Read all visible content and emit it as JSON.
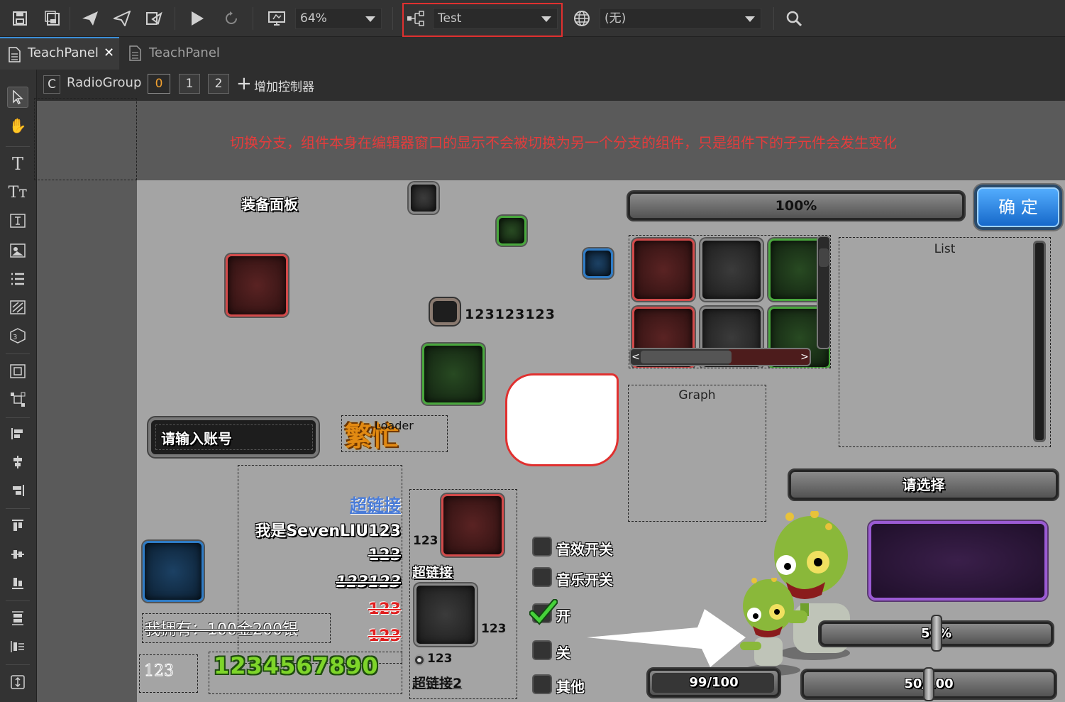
{
  "toolbar": {
    "zoom": "64%",
    "controller_select": "Test",
    "language_select": "(无)",
    "highlight_color": "#e0302f"
  },
  "tabs": [
    {
      "label": "TeachPanel",
      "active": true
    },
    {
      "label": "TeachPanel",
      "active": false
    }
  ],
  "controller_bar": {
    "type_icon": "C",
    "name": "RadioGroup",
    "pages": [
      "0",
      "1",
      "2"
    ],
    "selected_page": "0",
    "add_label": "增加控制器"
  },
  "canvas": {
    "notice": "切换分支，组件本身在编辑器窗口的显示不会被切换为另一个分支的组件，只是组件下的子元件会发生变化",
    "panel_title": "装备面板",
    "progress_label": "100%",
    "confirm_button": "确 定",
    "icon_number": "123123123",
    "list_label": "List",
    "graph_label": "Graph",
    "loader_label": "Loader",
    "loader_image_text": "繁忙",
    "account_input": "请输入账号",
    "select_button": "请选择",
    "rich_text": [
      "超链接",
      "我是SevenLIU123",
      "123",
      "123123",
      "123",
      "123"
    ],
    "ownership_text": "我拥有：100金200银",
    "bitmap_number": "123",
    "green_number": "1234567890",
    "button_group": {
      "item1_label": "123",
      "link1": "超链接",
      "item2_label": "123",
      "radio_label": "123",
      "link2": "超链接2"
    },
    "checkboxes": [
      {
        "label": "音效开关",
        "checked": false
      },
      {
        "label": "音乐开关",
        "checked": false
      },
      {
        "label": "开",
        "checked": true
      },
      {
        "label": "关",
        "checked": false
      },
      {
        "label": "其他",
        "checked": false
      }
    ],
    "slider1_label": "50%",
    "slider1_value": 0.5,
    "progress2_label": "99/100",
    "progress2_value": 0.99,
    "slider2_label": "50/100",
    "slider2_value": 0.5
  }
}
